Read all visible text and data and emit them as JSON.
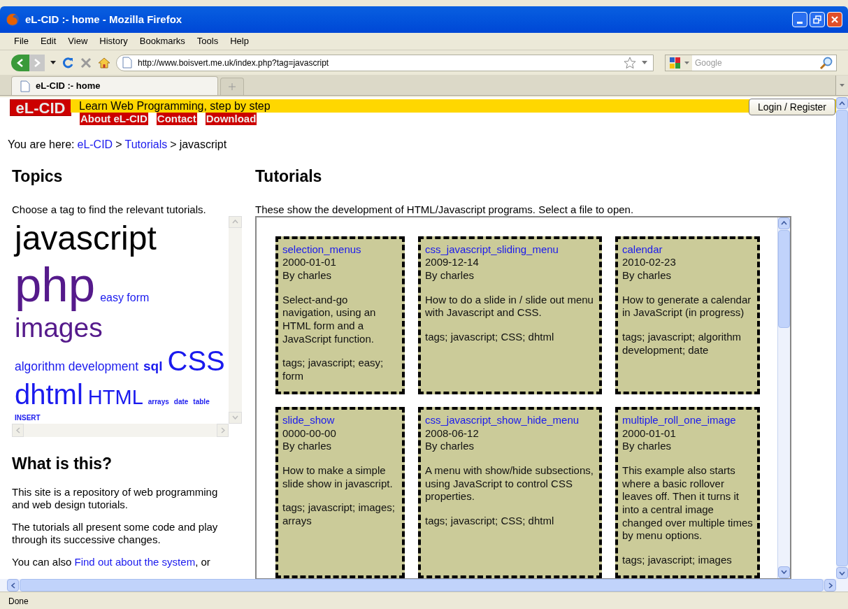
{
  "window": {
    "title": "eL-CID :- home - Mozilla Firefox"
  },
  "menu": [
    "File",
    "Edit",
    "View",
    "History",
    "Bookmarks",
    "Tools",
    "Help"
  ],
  "navigation": {
    "url": "http://www.boisvert.me.uk/index.php?tag=javascript",
    "search_placeholder": "Google"
  },
  "tabs": [
    {
      "label": "eL-CID :- home",
      "selected": true
    }
  ],
  "site_header": {
    "logo": "eL-CID",
    "tagline": "Learn Web Programming, step by step",
    "links": [
      "About eL-CID",
      "Contact",
      "Download"
    ],
    "login_button": "Login / Register"
  },
  "breadcrumb": {
    "prefix": "You are here:",
    "links": [
      "eL-CID",
      "Tutorials"
    ],
    "separator": ">",
    "current": "javascript"
  },
  "sidebar": {
    "topics_heading": "Topics",
    "topics_intro": "Choose a tag to find the relevant tutorials.",
    "tags": [
      {
        "label": "javascript",
        "kind": "huge",
        "visited": false,
        "selected": true
      },
      {
        "label": "php",
        "kind": "giant",
        "visited": true,
        "selected": false
      },
      {
        "label": "easy form",
        "kind": "medium",
        "visited": false,
        "selected": false
      },
      {
        "label": "images",
        "kind": "large",
        "visited": true,
        "selected": false
      },
      {
        "label": "algorithm development",
        "kind": "medium-plus",
        "visited": false,
        "selected": false
      },
      {
        "label": "sql",
        "kind": "bold",
        "visited": false,
        "selected": false
      },
      {
        "label": "CSS",
        "kind": "big",
        "visited": false,
        "selected": false
      },
      {
        "label": "dhtml",
        "kind": "big",
        "visited": false,
        "selected": false
      },
      {
        "label": "HTML",
        "kind": "medium-large",
        "visited": false,
        "selected": false
      },
      {
        "label": "arrays",
        "kind": "tiny",
        "visited": false,
        "selected": false
      },
      {
        "label": "date",
        "kind": "tiny",
        "visited": false,
        "selected": false
      },
      {
        "label": "table",
        "kind": "tiny",
        "visited": false,
        "selected": false
      },
      {
        "label": "INSERT",
        "kind": "tiny",
        "visited": false,
        "selected": false
      }
    ],
    "about_heading": "What is this?",
    "paragraphs": [
      {
        "text": "This site is a repository of web programming and web design tutorials."
      },
      {
        "text": "The tutorials all present some code and play through its successive changes."
      },
      {
        "text": "You can also ",
        "link": "Find out about the system",
        "after": ", or"
      }
    ]
  },
  "main": {
    "heading": "Tutorials",
    "intro": "These show the development of HTML/Javascript programs. Select a file to open.",
    "tutorials": [
      {
        "title": "selection_menus",
        "date": "2000-01-01",
        "author": "By charles",
        "description": "Select-and-go navigation, using an HTML form and a JavaScript function.",
        "tags": "tags; javascript; easy; form"
      },
      {
        "title": "css_javascript_sliding_menu",
        "date": "2009-12-14",
        "author": "By charles",
        "description": "How to do a slide in / slide out menu with Javascript and CSS.",
        "tags": "tags; javascript; CSS; dhtml"
      },
      {
        "title": "calendar",
        "date": "2010-02-23",
        "author": "By charles",
        "description": "How to generate a calendar in JavaScript (in progress)",
        "tags": "tags; javascript; algorithm development; date"
      },
      {
        "title": "slide_show",
        "date": "0000-00-00",
        "author": "By charles",
        "description": "How to make a simple slide show in javascript.",
        "tags": "tags; javascript; images; arrays"
      },
      {
        "title": "css_javascript_show_hide_menu",
        "date": "2008-06-12",
        "author": "By charles",
        "description": "A menu with show/hide subsections, using JavaScript to control CSS properties.",
        "tags": "tags; javascript; CSS; dhtml"
      },
      {
        "title": "multiple_roll_one_image",
        "date": "2000-01-01",
        "author": "By charles",
        "description": "This example also starts where a basic rollover leaves off. Then it turns it into a central image changed over multiple times by menu options.",
        "tags": "tags; javascript; images"
      }
    ]
  },
  "status_bar": {
    "text": "Done"
  }
}
